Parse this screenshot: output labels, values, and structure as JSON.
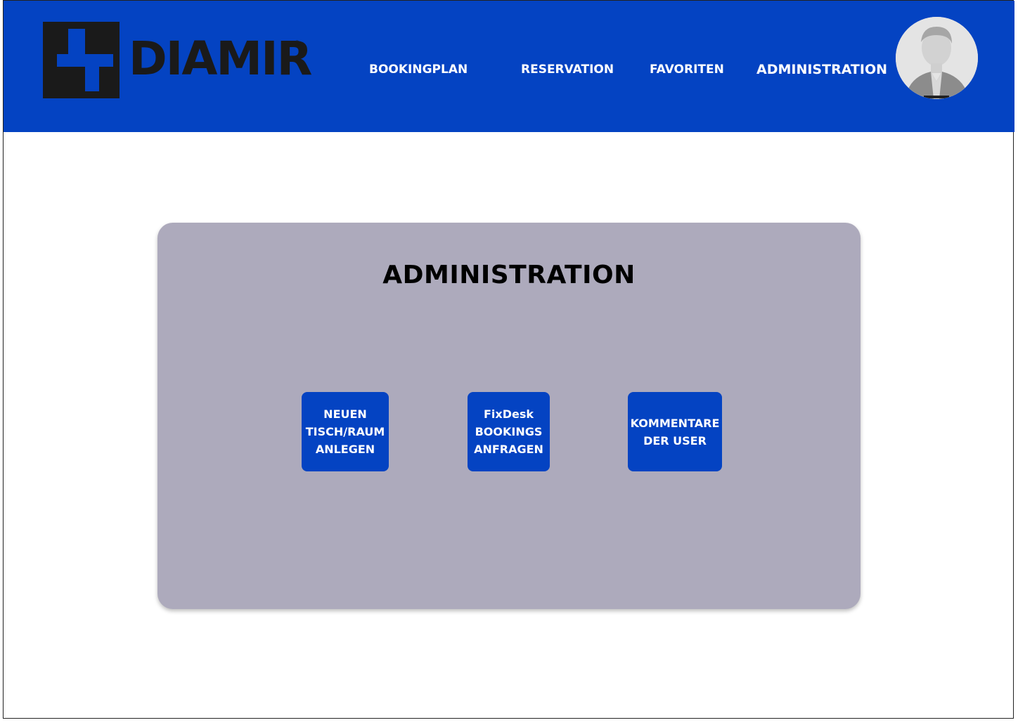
{
  "brand": {
    "name": "DIAMIR",
    "registered_mark": "®",
    "color_primary": "#0443c2",
    "panel_color": "#adaabc"
  },
  "nav": {
    "items": [
      {
        "label": "BOOKINGPLAN"
      },
      {
        "label": "RESERVATION"
      },
      {
        "label": "FAVORITEN"
      },
      {
        "label": "ADMINISTRATION",
        "active": true
      }
    ]
  },
  "user": {
    "avatar_icon": "user-avatar-icon"
  },
  "main": {
    "title": "ADMINISTRATION",
    "tiles": [
      {
        "label": "NEUEN\nTISCH/RAUM\nANLEGEN"
      },
      {
        "label": "FixDesk\nBOOKINGS\nANFRAGEN"
      },
      {
        "label": "KOMMENTARE\nDER USER"
      }
    ]
  }
}
